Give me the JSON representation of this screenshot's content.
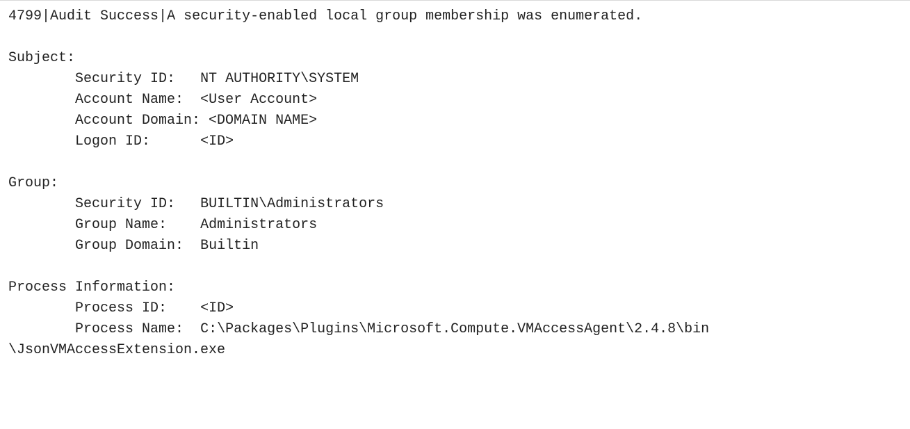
{
  "header": {
    "event_id": "4799",
    "sep": "|",
    "keyword": "Audit Success",
    "message": "A security-enabled local group membership was enumerated."
  },
  "subject": {
    "heading": "Subject:",
    "security_id": {
      "label": "Security ID:",
      "value": "NT AUTHORITY\\SYSTEM"
    },
    "account_name": {
      "label": "Account Name:",
      "value": "<User Account>"
    },
    "account_domain": {
      "label": "Account Domain: ",
      "value": "<DOMAIN NAME>"
    },
    "logon_id": {
      "label": "Logon ID:",
      "value": "<ID>"
    }
  },
  "group": {
    "heading": "Group:",
    "security_id": {
      "label": "Security ID:",
      "value": "BUILTIN\\Administrators"
    },
    "group_name": {
      "label": "Group Name:",
      "value": "Administrators"
    },
    "group_domain": {
      "label": "Group Domain:",
      "value": "Builtin"
    }
  },
  "process": {
    "heading": "Process Information:",
    "process_id": {
      "label": "Process ID:",
      "value": "<ID>"
    },
    "process_name": {
      "label": "Process Name:",
      "value_line1": "C:\\Packages\\Plugins\\Microsoft.Compute.VMAccessAgent\\2.4.8\\bin",
      "value_line2": "\\JsonVMAccessExtension.exe"
    }
  }
}
